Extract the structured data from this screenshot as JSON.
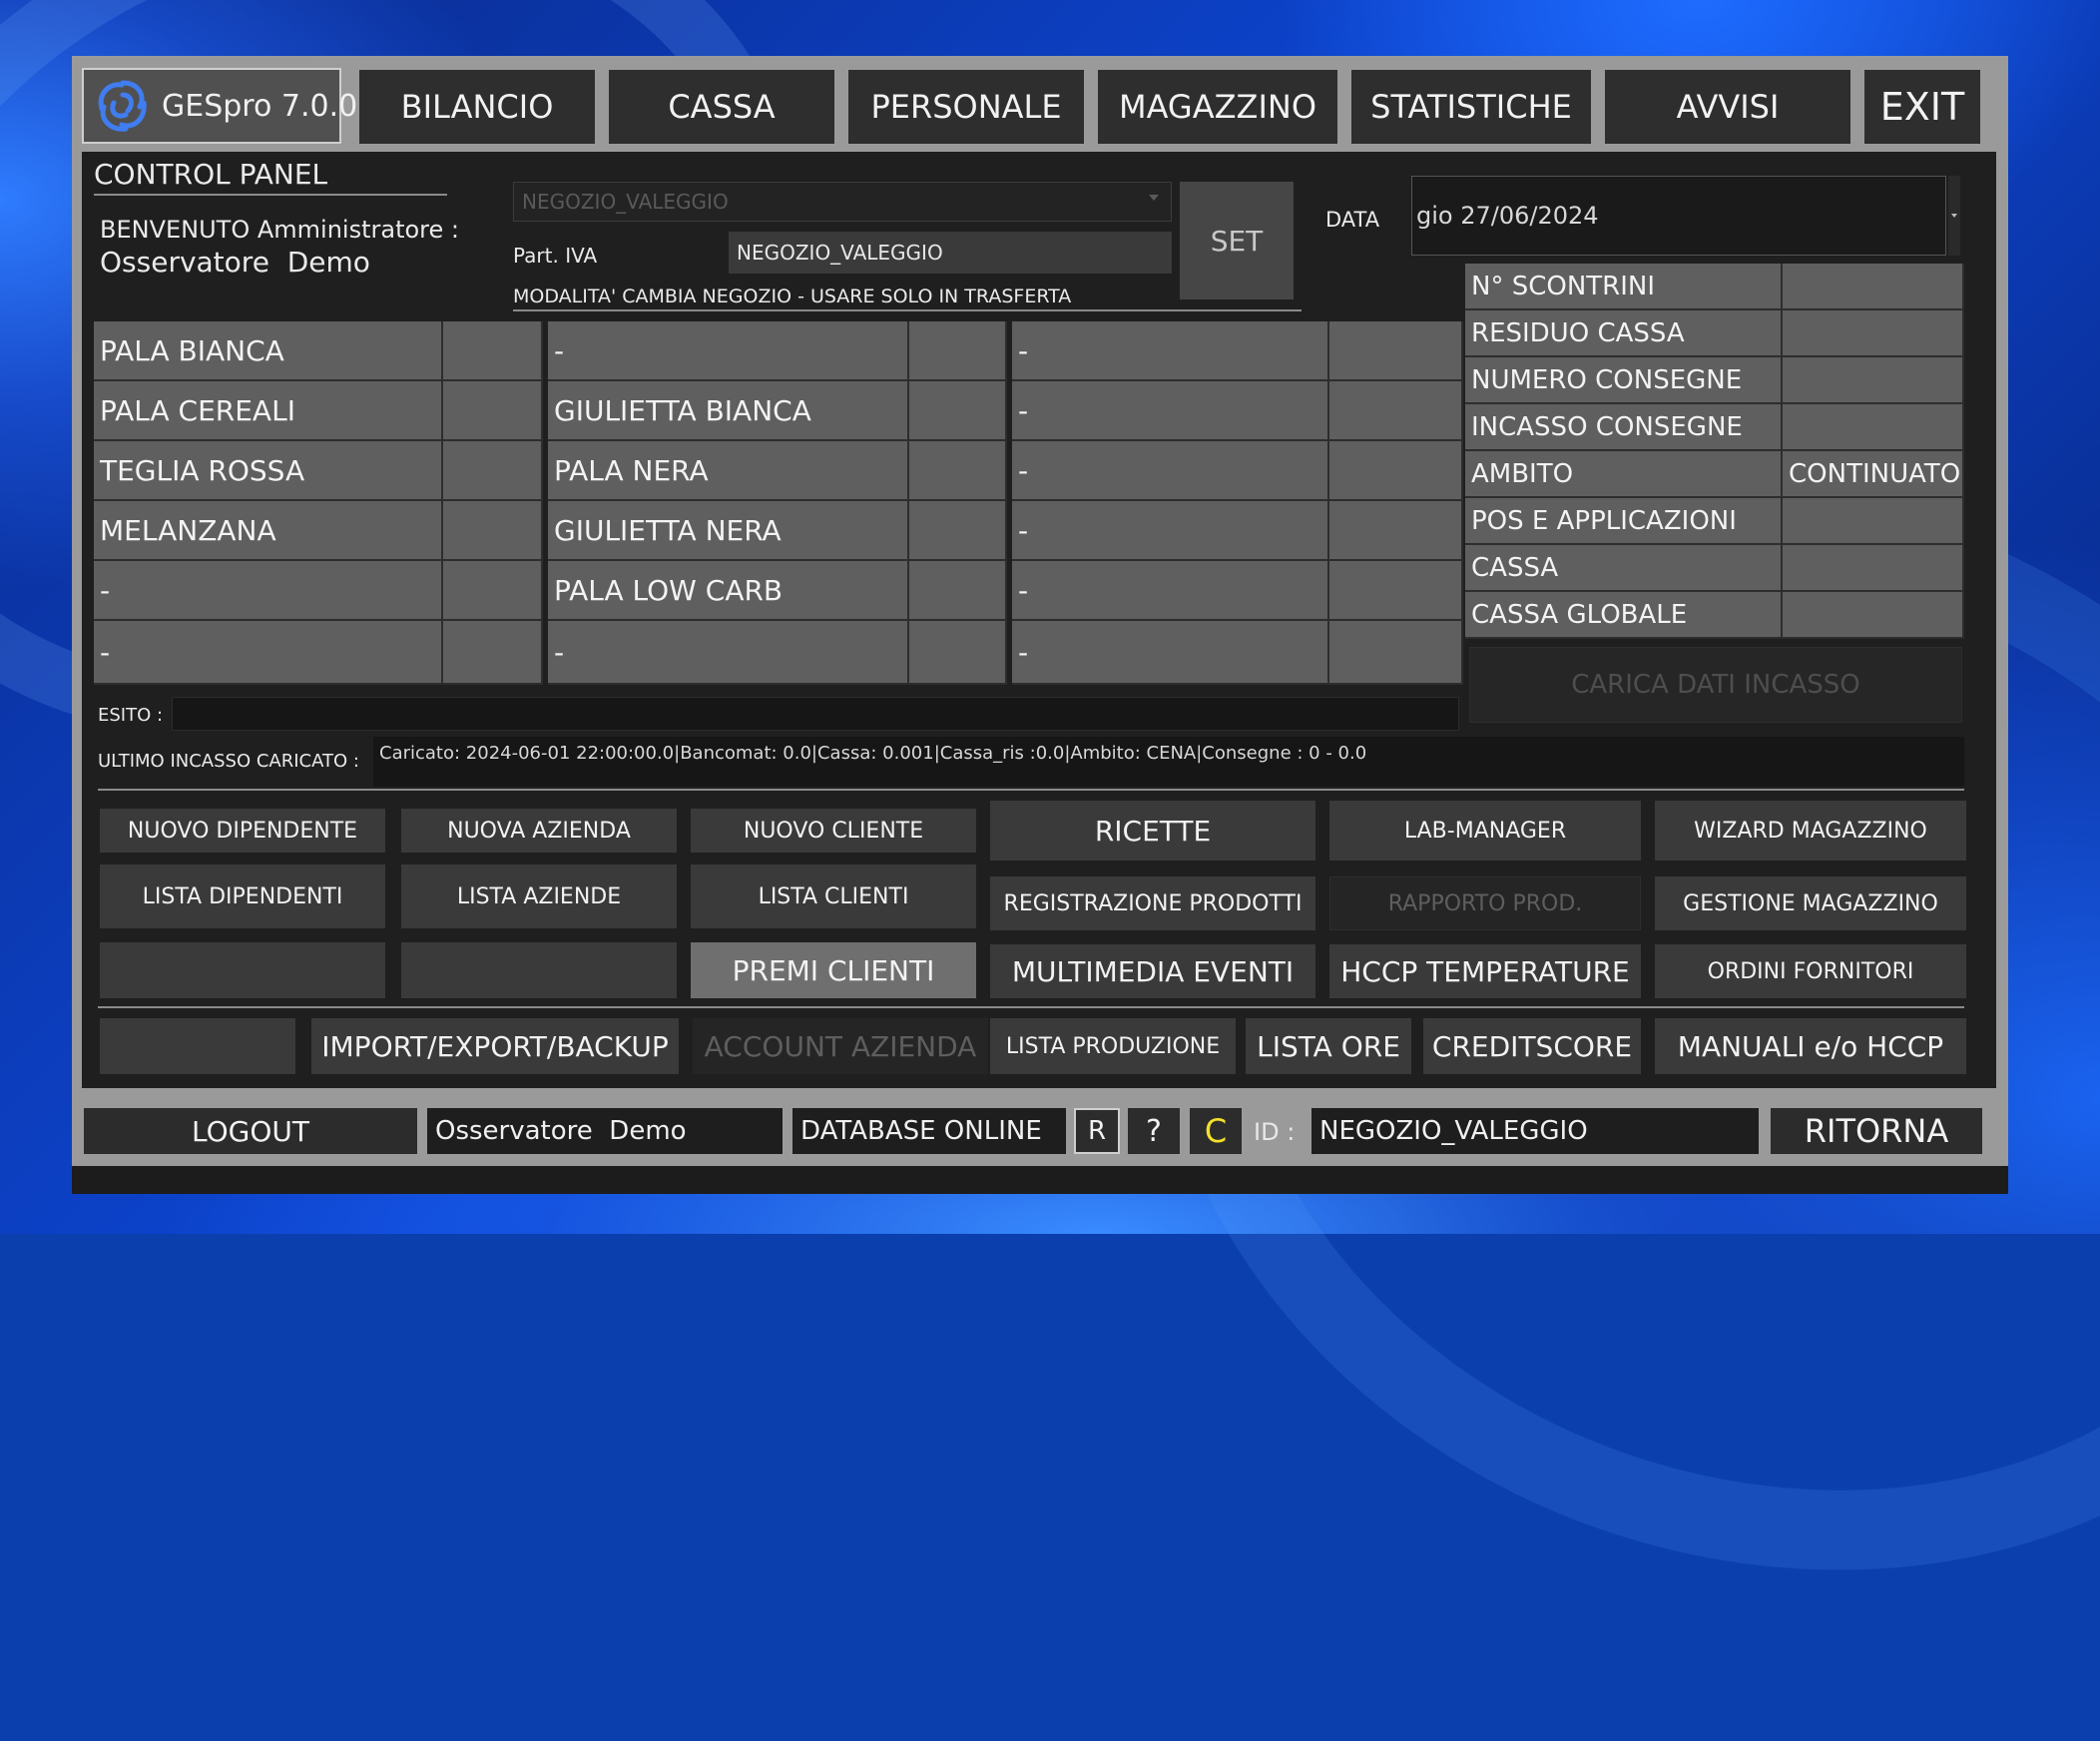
{
  "app": {
    "name": "GESpro 7.0.0"
  },
  "nav": {
    "items": [
      "BILANCIO",
      "CASSA",
      "PERSONALE",
      "MAGAZZINO",
      "STATISTICHE",
      "AVVISI"
    ],
    "exit": "EXIT"
  },
  "control": {
    "title": "CONTROL PANEL",
    "welcome": "BENVENUTO Amministratore :",
    "user": "Osservatore  Demo",
    "store_select": "NEGOZIO_VALEGGIO",
    "piva_label": "Part. IVA",
    "piva_value": "NEGOZIO_VALEGGIO",
    "set_label": "SET",
    "mode_note": "MODALITA' CAMBIA NEGOZIO - USARE SOLO IN TRASFERTA",
    "date_label": "DATA",
    "date_value": "gio 27/06/2024"
  },
  "products": {
    "col1": [
      "PALA BIANCA",
      "PALA CEREALI",
      "TEGLIA ROSSA",
      "MELANZANA",
      "-",
      "-"
    ],
    "col2": [
      "-",
      "GIULIETTA BIANCA",
      "PALA NERA",
      "GIULIETTA NERA",
      "PALA LOW CARB",
      "-"
    ],
    "col3": [
      "-",
      "-",
      "-",
      "-",
      "-",
      "-"
    ]
  },
  "stats": [
    {
      "label": "N° SCONTRINI",
      "value": ""
    },
    {
      "label": "RESIDUO CASSA",
      "value": ""
    },
    {
      "label": "NUMERO CONSEGNE",
      "value": ""
    },
    {
      "label": "INCASSO CONSEGNE",
      "value": ""
    },
    {
      "label": "AMBITO",
      "value": "CONTINUATO"
    },
    {
      "label": "POS E APPLICAZIONI",
      "value": ""
    },
    {
      "label": "CASSA",
      "value": ""
    },
    {
      "label": "CASSA GLOBALE",
      "value": ""
    }
  ],
  "carica": "CARICA DATI INCASSO",
  "esito": {
    "label": "ESITO :",
    "value": ""
  },
  "ultimo": {
    "label": "ULTIMO INCASSO CARICATO :",
    "value": "Caricato: 2024-06-01 22:00:00.0|Bancomat: 0.0|Cassa: 0.001|Cassa_ris :0.0|Ambito: CENA|Consegne : 0 - 0.0"
  },
  "actions": {
    "nuovo_dipendente": "NUOVO DIPENDENTE",
    "nuova_azienda": "NUOVA AZIENDA",
    "nuovo_cliente": "NUOVO CLIENTE",
    "ricette": "RICETTE",
    "lab_manager": "LAB-MANAGER",
    "wizard_magazzino": "WIZARD MAGAZZINO",
    "lista_dipendenti": "LISTA DIPENDENTI",
    "lista_aziende": "LISTA AZIENDE",
    "lista_clienti": "LISTA CLIENTI",
    "registrazione_prodotti": "REGISTRAZIONE PRODOTTI",
    "rapporto_prod": "RAPPORTO PROD.",
    "gestione_magazzino": "GESTIONE MAGAZZINO",
    "premi_clienti": "PREMI CLIENTI",
    "multimedia_eventi": "MULTIMEDIA EVENTI",
    "hccp_temperature": "HCCP TEMPERATURE",
    "ordini_fornitori": "ORDINI FORNITORI",
    "import_export": "IMPORT/EXPORT/BACKUP",
    "account_azienda": "ACCOUNT AZIENDA",
    "lista_produzione": "LISTA PRODUZIONE",
    "lista_ore": "LISTA ORE",
    "creditscore": "CREDITSCORE",
    "manuali": "MANUALI e/o HCCP"
  },
  "footer": {
    "logout": "LOGOUT",
    "user": "Osservatore  Demo",
    "db_status": "DATABASE ONLINE",
    "r": "R",
    "help": "?",
    "c": "C",
    "id_label": "ID :",
    "id_value": "NEGOZIO_VALEGGIO",
    "ritorna": "RITORNA"
  }
}
